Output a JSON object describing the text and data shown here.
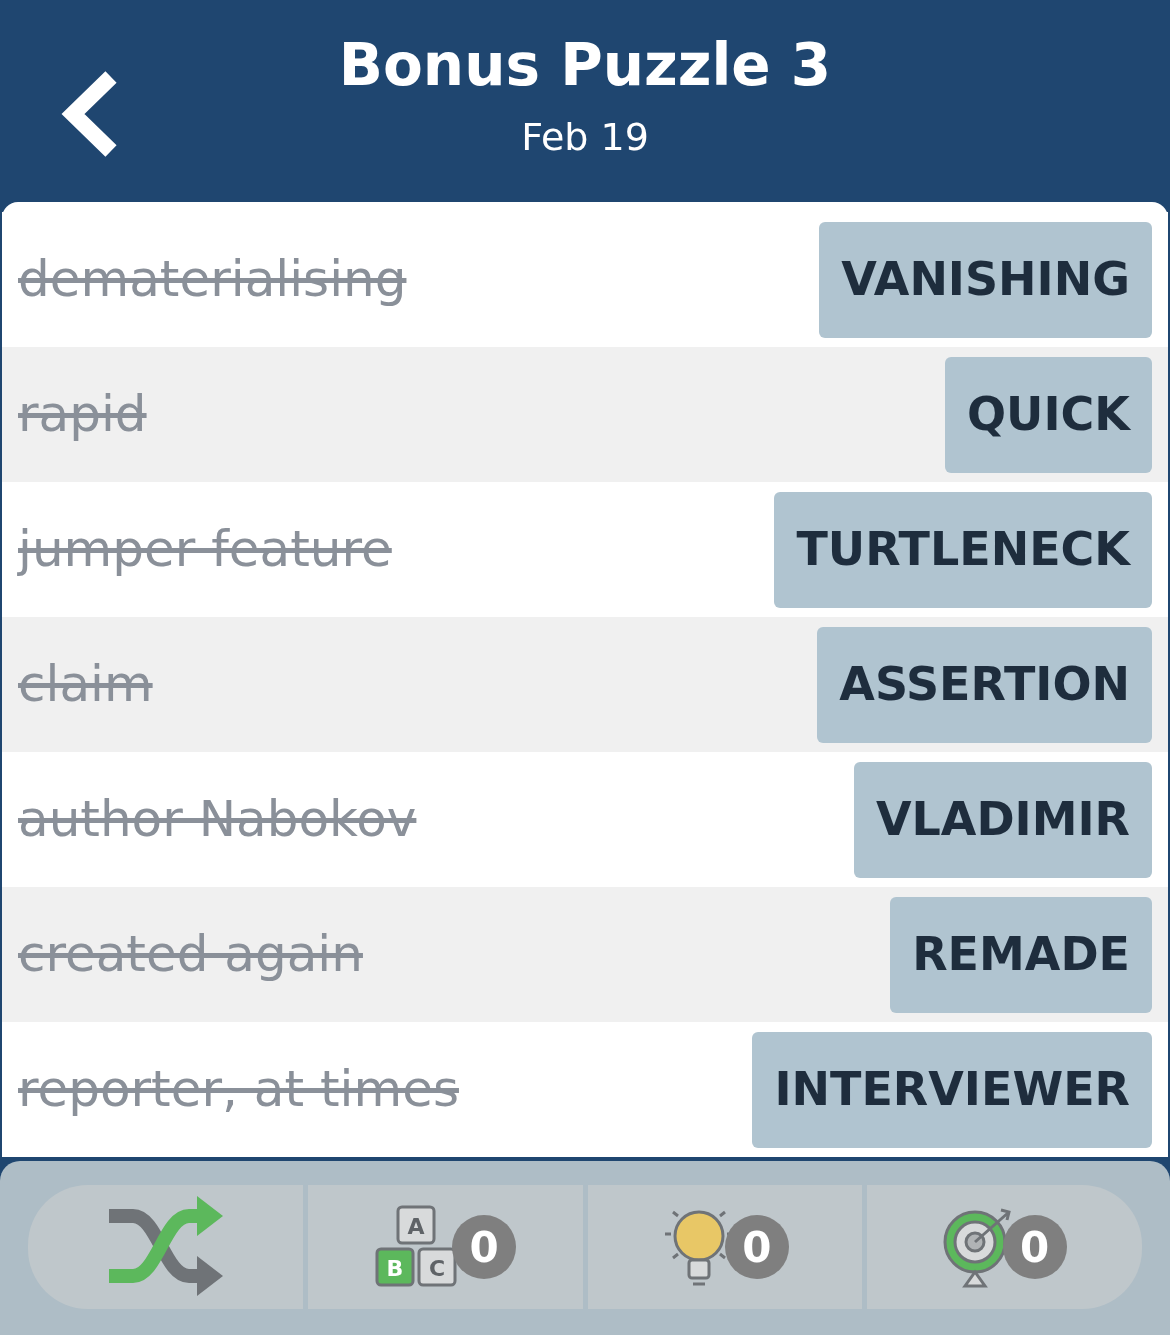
{
  "header": {
    "title": "Bonus Puzzle 3",
    "subtitle": "Feb 19"
  },
  "clues": [
    {
      "clue": "dematerialising",
      "answer": "VANISHING",
      "solved": true
    },
    {
      "clue": "rapid",
      "answer": "QUICK",
      "solved": true
    },
    {
      "clue": "jumper feature",
      "answer": "TURTLENECK",
      "solved": true
    },
    {
      "clue": "claim",
      "answer": "ASSERTION",
      "solved": true
    },
    {
      "clue": "author Nabokov",
      "answer": "VLADIMIR",
      "solved": true
    },
    {
      "clue": "created again",
      "answer": "REMADE",
      "solved": true
    },
    {
      "clue": "reporter, at times",
      "answer": "INTERVIEWER",
      "solved": true
    }
  ],
  "toolbar": [
    {
      "kind": "shuffle"
    },
    {
      "kind": "letters",
      "count": "0",
      "blocks": [
        "A",
        "B",
        "C"
      ]
    },
    {
      "kind": "hint",
      "count": "0"
    },
    {
      "kind": "target",
      "count": "0"
    }
  ]
}
